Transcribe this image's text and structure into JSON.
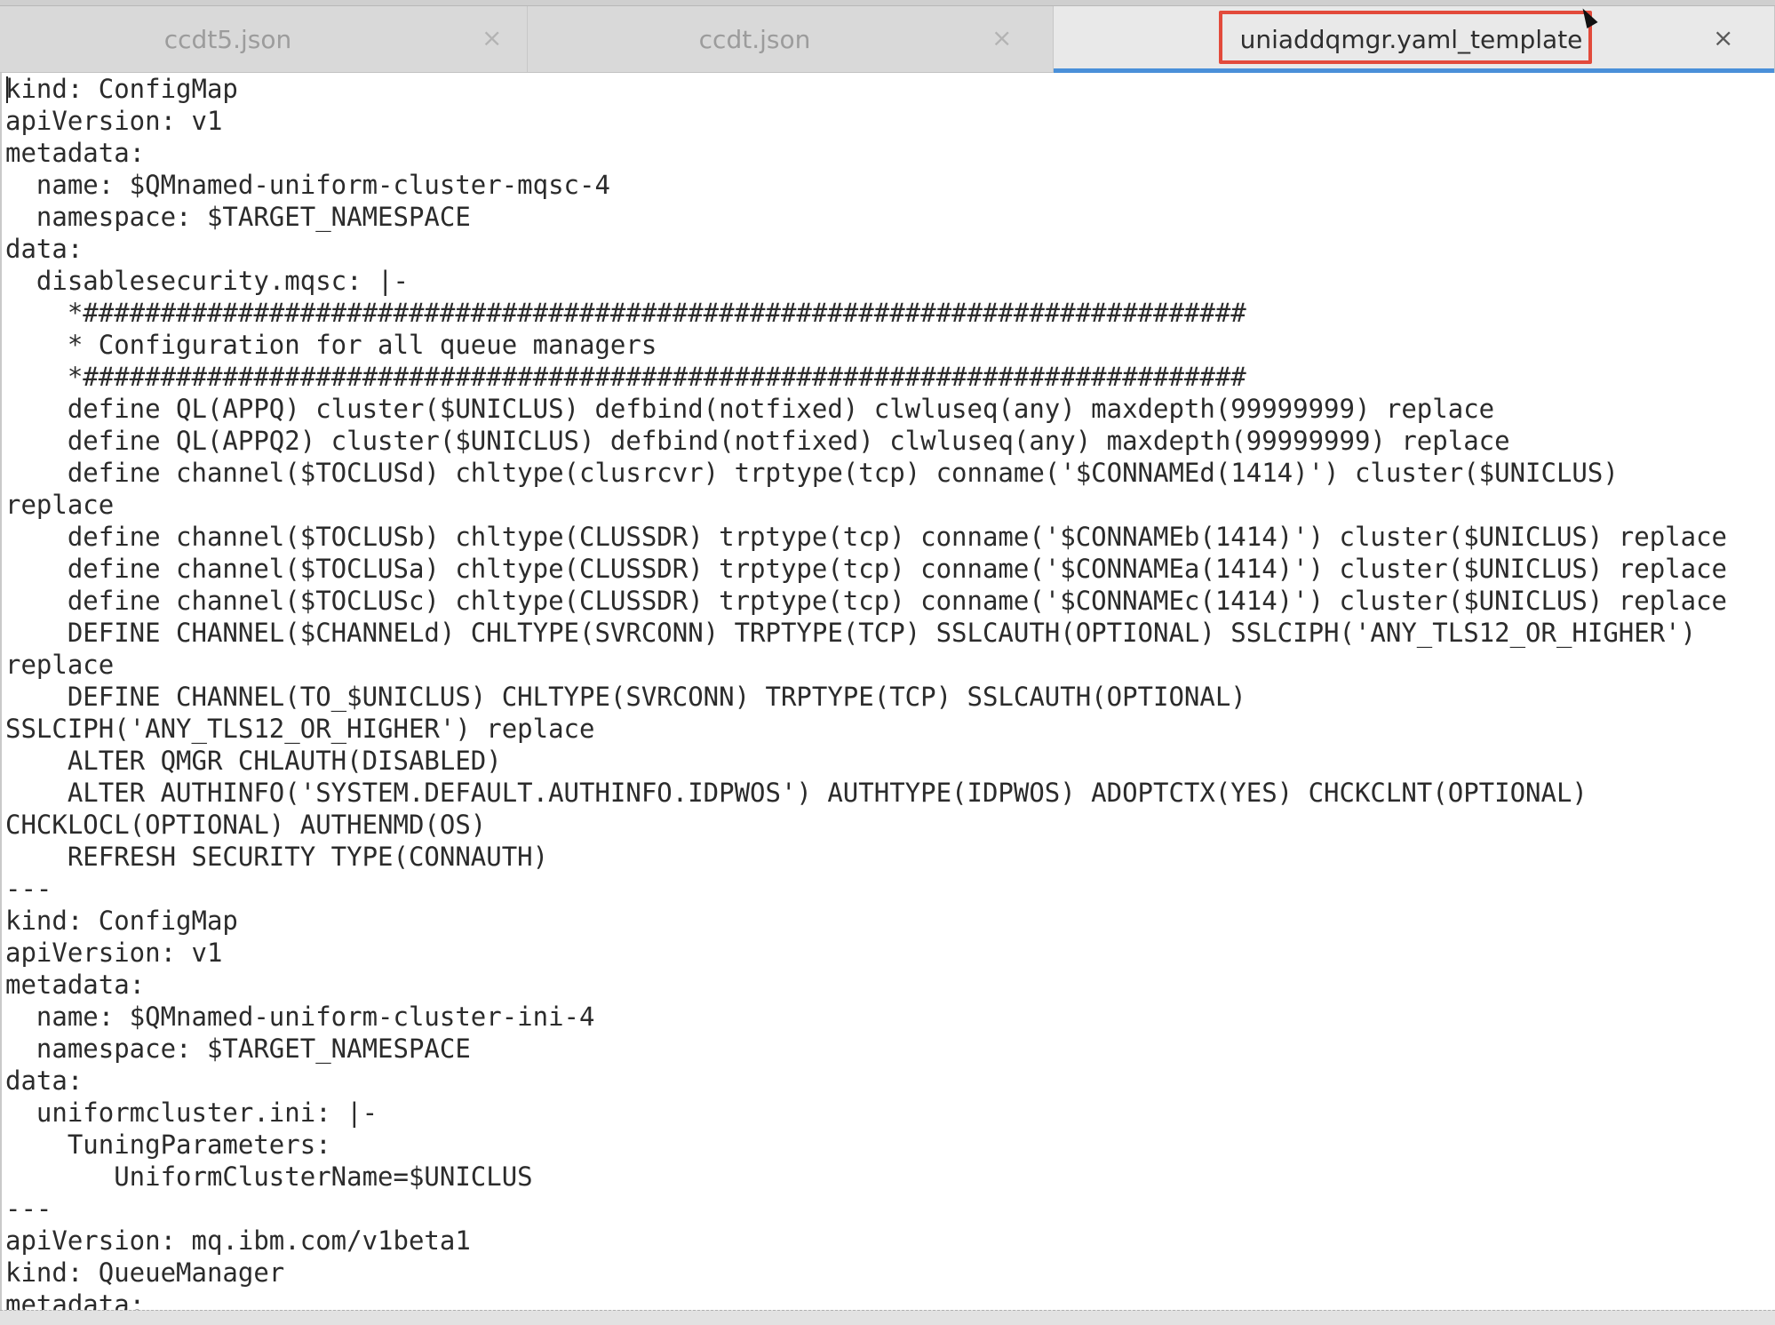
{
  "tabs": [
    {
      "label": "ccdt5.json",
      "close": "×",
      "active": false
    },
    {
      "label": "ccdt.json",
      "close": "×",
      "active": false
    },
    {
      "label": "uniaddqmgr.yaml_template",
      "close": "×",
      "active": true
    }
  ],
  "editor": {
    "lines": [
      "kind: ConfigMap",
      "apiVersion: v1",
      "metadata:",
      "  name: $QMnamed-uniform-cluster-mqsc-4",
      "  namespace: $TARGET_NAMESPACE",
      "data:",
      "  disablesecurity.mqsc: |-",
      "    *###########################################################################",
      "    * Configuration for all queue managers",
      "    *###########################################################################",
      "    define QL(APPQ) cluster($UNICLUS) defbind(notfixed) clwluseq(any) maxdepth(99999999) replace",
      "    define QL(APPQ2) cluster($UNICLUS) defbind(notfixed) clwluseq(any) maxdepth(99999999) replace",
      "    define channel($TOCLUSd) chltype(clusrcvr) trptype(tcp) conname('$CONNAMEd(1414)') cluster($UNICLUS)",
      "replace",
      "    define channel($TOCLUSb) chltype(CLUSSDR) trptype(tcp) conname('$CONNAMEb(1414)') cluster($UNICLUS) replace",
      "    define channel($TOCLUSa) chltype(CLUSSDR) trptype(tcp) conname('$CONNAMEa(1414)') cluster($UNICLUS) replace",
      "    define channel($TOCLUSc) chltype(CLUSSDR) trptype(tcp) conname('$CONNAMEc(1414)') cluster($UNICLUS) replace",
      "    DEFINE CHANNEL($CHANNELd) CHLTYPE(SVRCONN) TRPTYPE(TCP) SSLCAUTH(OPTIONAL) SSLCIPH('ANY_TLS12_OR_HIGHER')",
      "replace",
      "    DEFINE CHANNEL(TO_$UNICLUS) CHLTYPE(SVRCONN) TRPTYPE(TCP) SSLCAUTH(OPTIONAL)",
      "SSLCIPH('ANY_TLS12_OR_HIGHER') replace",
      "    ALTER QMGR CHLAUTH(DISABLED)",
      "    ALTER AUTHINFO('SYSTEM.DEFAULT.AUTHINFO.IDPWOS') AUTHTYPE(IDPWOS) ADOPTCTX(YES) CHCKCLNT(OPTIONAL)",
      "CHCKLOCL(OPTIONAL) AUTHENMD(OS)",
      "    REFRESH SECURITY TYPE(CONNAUTH)",
      "---",
      "kind: ConfigMap",
      "apiVersion: v1",
      "metadata:",
      "  name: $QMnamed-uniform-cluster-ini-4",
      "  namespace: $TARGET_NAMESPACE",
      "data:",
      "  uniformcluster.ini: |-",
      "    TuningParameters:",
      "       UniformClusterName=$UNICLUS",
      "---",
      "apiVersion: mq.ibm.com/v1beta1",
      "kind: QueueManager",
      "metadata:"
    ]
  }
}
